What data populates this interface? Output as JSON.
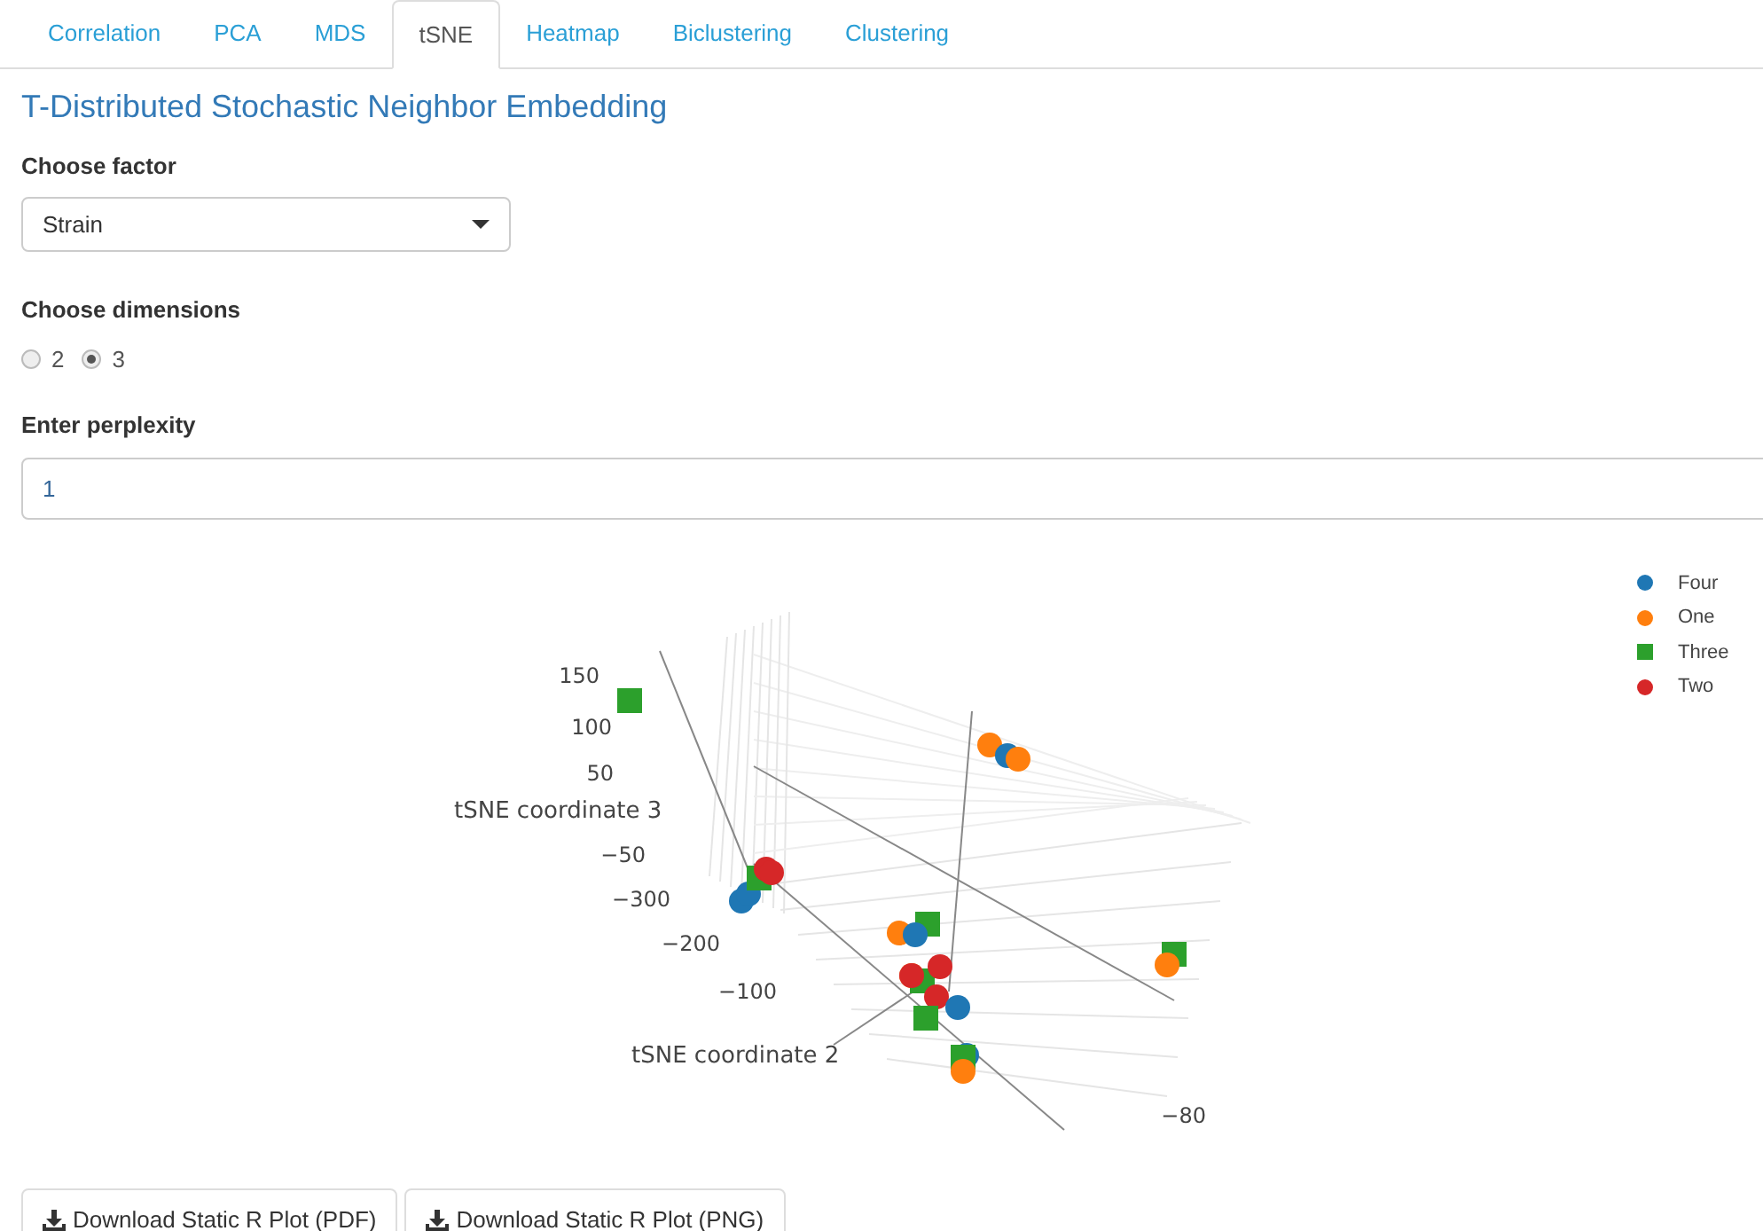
{
  "tabs": [
    {
      "label": "Correlation",
      "selected": false
    },
    {
      "label": "PCA",
      "selected": false
    },
    {
      "label": "MDS",
      "selected": false
    },
    {
      "label": "tSNE",
      "selected": true
    },
    {
      "label": "Heatmap",
      "selected": false
    },
    {
      "label": "Biclustering",
      "selected": false
    },
    {
      "label": "Clustering",
      "selected": false
    }
  ],
  "heading": "T-Distributed Stochastic Neighbor Embedding",
  "factor": {
    "label": "Choose factor",
    "value": "Strain"
  },
  "dimensions": {
    "label": "Choose dimensions",
    "options": [
      {
        "label": "2",
        "selected": false
      },
      {
        "label": "3",
        "selected": true
      }
    ]
  },
  "perplexity": {
    "label": "Enter perplexity",
    "value": "1"
  },
  "plot": {
    "axis_titles": [
      "tSNE coordinate 3",
      "tSNE coordinate 2"
    ],
    "tick_labels": [
      "150",
      "100",
      "50",
      "−50",
      "−300",
      "−200",
      "−100",
      "−80"
    ],
    "legend": [
      {
        "label": "Four",
        "color": "#1f77b4",
        "kind": "circle"
      },
      {
        "label": "One",
        "color": "#ff7f0e",
        "kind": "circle"
      },
      {
        "label": "Three",
        "color": "#2ca02c",
        "kind": "square"
      },
      {
        "label": "Two",
        "color": "#d62728",
        "kind": "circle"
      }
    ]
  },
  "buttons": [
    "Download Static R Plot (PDF)",
    "Download Static R Plot (PNG)"
  ]
}
